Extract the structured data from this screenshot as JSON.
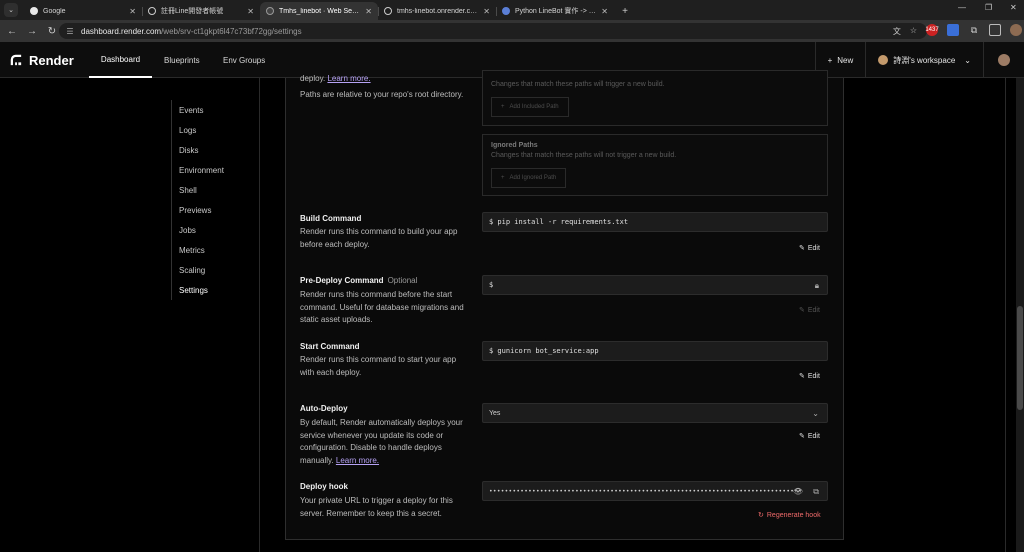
{
  "browser": {
    "tabs": [
      {
        "title": "Google",
        "icon": "google-icon"
      },
      {
        "title": "註冊Line開發者帳號",
        "icon": "page-icon"
      },
      {
        "title": "Tmhs_linebot · Web Service",
        "icon": "render-icon",
        "active": true
      },
      {
        "title": "tmhs-linebot.onrender.com",
        "icon": "globe-icon"
      },
      {
        "title": "Python LineBot 實作 -> 註冊H",
        "icon": "page-icon"
      }
    ],
    "url_host": "dashboard.render.com",
    "url_path": "/web/srv-ct1gkpt6l47c73bf72gg/settings",
    "badge": "1437"
  },
  "nav": {
    "logo": "Render",
    "tabs": [
      "Dashboard",
      "Blueprints",
      "Env Groups"
    ],
    "new_label": "New",
    "workspace": "詩淵's workspace"
  },
  "sidebar": {
    "items": [
      "Events",
      "Logs",
      "Disks",
      "Environment",
      "Shell",
      "Previews",
      "Jobs",
      "Metrics",
      "Scaling",
      "Settings"
    ],
    "active": "Settings"
  },
  "build_filters": {
    "intro_top": "deploy.",
    "learn_more": "Learn more.",
    "paths_note": "Paths are relative to your repo's root directory.",
    "included_hint": "Changes that match these paths will trigger a new build.",
    "add_included": "Add Included Path",
    "ignored_title": "Ignored Paths",
    "ignored_hint": "Changes that match these paths will not trigger a new build.",
    "add_ignored": "Add Ignored Path"
  },
  "build_command": {
    "title": "Build Command",
    "desc": "Render runs this command to build your app before each deploy.",
    "value": "$ pip install -r requirements.txt",
    "edit": "Edit"
  },
  "predeploy_command": {
    "title": "Pre-Deploy Command",
    "optional": "Optional",
    "desc": "Render runs this command before the start command. Useful for database migrations and static asset uploads.",
    "value": "$",
    "edit": "Edit"
  },
  "start_command": {
    "title": "Start Command",
    "desc": "Render runs this command to start your app with each deploy.",
    "value": "$ gunicorn bot_service:app",
    "edit": "Edit"
  },
  "auto_deploy": {
    "title": "Auto-Deploy",
    "desc": "By default, Render automatically deploys your service whenever you update its code or configuration. Disable to handle deploys manually.",
    "learn_more": "Learn more.",
    "value": "Yes",
    "edit": "Edit"
  },
  "deploy_hook": {
    "title": "Deploy hook",
    "desc": "Your private URL to trigger a deploy for this server. Remember to keep this a secret.",
    "value": "••••••••••••••••••••••••••••••••••••••••••••••••••••••••••••••••••••••••••••••••",
    "regenerate": "Regenerate hook"
  }
}
